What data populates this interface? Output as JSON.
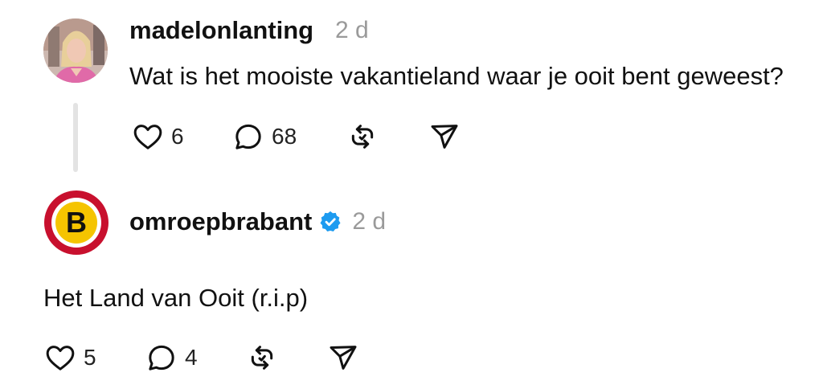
{
  "posts": [
    {
      "username": "madelonlanting",
      "time": "2 d",
      "text": "Wat is het mooiste vakantieland waar je ooit bent geweest?",
      "likes": "6",
      "replies": "68",
      "avatar_icon": "user-photo"
    },
    {
      "username": "omroepbrabant",
      "verified": true,
      "time": "2 d",
      "text": "Het Land van Ooit (r.i.p)",
      "likes": "5",
      "replies": "4",
      "avatar_logo_letter": "B"
    }
  ],
  "colors": {
    "verified": "#1d9bf0",
    "logo_red": "#c8102e",
    "logo_yellow": "#f5c400"
  }
}
